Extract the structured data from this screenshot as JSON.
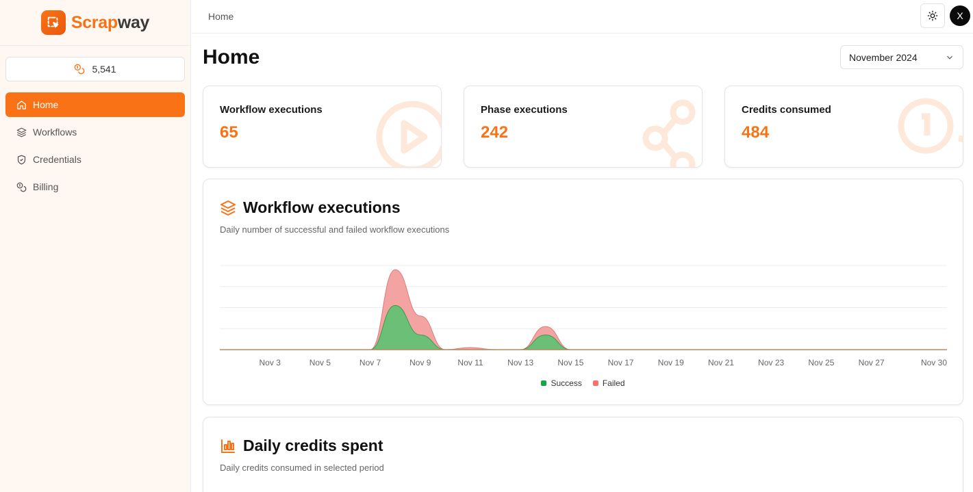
{
  "app": {
    "logo_part1": "Scrap",
    "logo_part2": "way"
  },
  "sidebar": {
    "credits": "5,541",
    "items": [
      {
        "label": "Home",
        "icon": "home-icon",
        "active": true
      },
      {
        "label": "Workflows",
        "icon": "layers-icon",
        "active": false
      },
      {
        "label": "Credentials",
        "icon": "shield-icon",
        "active": false
      },
      {
        "label": "Billing",
        "icon": "coins-icon",
        "active": false
      }
    ]
  },
  "topbar": {
    "breadcrumb": "Home",
    "avatar_initial": "X"
  },
  "page": {
    "title": "Home",
    "period": "November 2024"
  },
  "stats": [
    {
      "label": "Workflow executions",
      "value": "65",
      "icon": "play-circle-icon"
    },
    {
      "label": "Phase executions",
      "value": "242",
      "icon": "share-nodes-icon"
    },
    {
      "label": "Credits consumed",
      "value": "484",
      "icon": "coins-icon"
    }
  ],
  "executions_card": {
    "title": "Workflow executions",
    "subtitle": "Daily number of successful and failed workflow executions",
    "legend": {
      "success": "Success",
      "failed": "Failed"
    }
  },
  "credits_card": {
    "title": "Daily credits spent",
    "subtitle": "Daily credits consumed in selected period"
  },
  "colors": {
    "accent": "#f97316",
    "success": "#16a34a",
    "failed": "#f87171"
  },
  "chart_data": {
    "type": "area",
    "stacked": true,
    "x": [
      "Nov 1",
      "Nov 2",
      "Nov 3",
      "Nov 4",
      "Nov 5",
      "Nov 6",
      "Nov 7",
      "Nov 8",
      "Nov 9",
      "Nov 10",
      "Nov 11",
      "Nov 12",
      "Nov 13",
      "Nov 14",
      "Nov 15",
      "Nov 16",
      "Nov 17",
      "Nov 18",
      "Nov 19",
      "Nov 20",
      "Nov 21",
      "Nov 22",
      "Nov 23",
      "Nov 24",
      "Nov 25",
      "Nov 26",
      "Nov 27",
      "Nov 28",
      "Nov 29",
      "Nov 30"
    ],
    "tick_labels": [
      "Nov 3",
      "Nov 5",
      "Nov 7",
      "Nov 9",
      "Nov 11",
      "Nov 13",
      "Nov 15",
      "Nov 17",
      "Nov 19",
      "Nov 21",
      "Nov 23",
      "Nov 25",
      "Nov 27",
      "Nov 30"
    ],
    "series": [
      {
        "name": "Success",
        "values": [
          0,
          0,
          0,
          0,
          0,
          0,
          0,
          21,
          7,
          0,
          0,
          0,
          0,
          7,
          0,
          0,
          0,
          0,
          0,
          0,
          0,
          0,
          0,
          0,
          0,
          0,
          0,
          0,
          0,
          0
        ]
      },
      {
        "name": "Failed",
        "values": [
          0,
          0,
          0,
          0,
          0,
          0,
          0,
          17,
          9,
          0,
          1,
          0,
          0,
          4,
          0,
          0,
          0,
          0,
          0,
          0,
          0,
          0,
          0,
          0,
          0,
          0,
          0,
          0,
          0,
          0
        ]
      }
    ],
    "ylim": [
      0,
      40
    ],
    "grid": true,
    "legend_position": "bottom"
  }
}
